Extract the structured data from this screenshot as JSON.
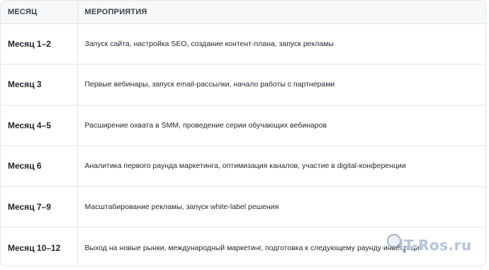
{
  "table": {
    "headers": [
      "МЕСЯЦ",
      "МЕРОПРИЯТИЯ"
    ],
    "rows": [
      {
        "period": "Месяц 1–2",
        "activity": "Запуск сайта, настройка SEO, создание контент-плана, запуск рекламы"
      },
      {
        "period": "Месяц 3",
        "activity": "Первые вебинары, запуск email-рассылки, начало работы с партнерами"
      },
      {
        "period": "Месяц 4–5",
        "activity": "Расширение охвата в SMM, проведение серии обучающих вебинаров"
      },
      {
        "period": "Месяц 6",
        "activity": "Аналитика первого раунда маркетинга, оптимизация каналов, участие в digital-конференции"
      },
      {
        "period": "Месяц 7–9",
        "activity": "Масштабирование рекламы, запуск white-label решения"
      },
      {
        "period": "Месяц 10–12",
        "activity": "Выход на новые рынки, международный маркетинг, подготовка к следующему раунду инвестиций"
      }
    ]
  },
  "watermark": {
    "text": "IT-Ros.ru",
    "icon": "magnifier-icon"
  },
  "colors": {
    "header_bg": "#f6f8fa",
    "border": "#e3e6ea",
    "text": "#1f2328"
  }
}
